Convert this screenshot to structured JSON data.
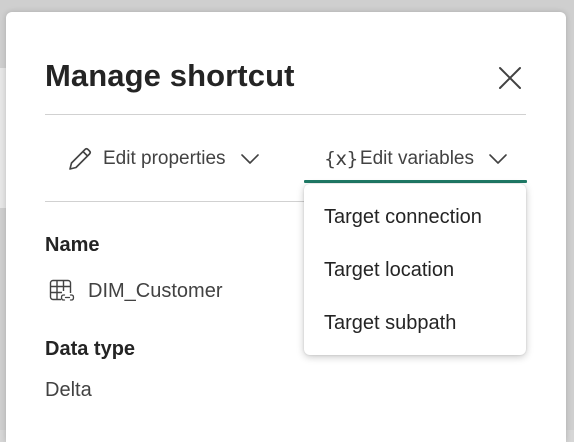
{
  "dialog": {
    "title": "Manage shortcut",
    "close_icon": "close-icon"
  },
  "toolbar": {
    "edit_properties_label": "Edit properties",
    "edit_properties_icon": "pencil-icon",
    "edit_variables_label": "Edit variables",
    "edit_variables_icon": "{x}",
    "active_tab_color": "#1f7a66"
  },
  "dropdown": {
    "items": [
      {
        "label": "Target connection"
      },
      {
        "label": "Target location"
      },
      {
        "label": "Target subpath"
      }
    ]
  },
  "details": {
    "name_label": "Name",
    "name_value": "DIM_Customer",
    "name_icon": "table-shortcut-icon",
    "data_type_label": "Data type",
    "data_type_value": "Delta"
  }
}
